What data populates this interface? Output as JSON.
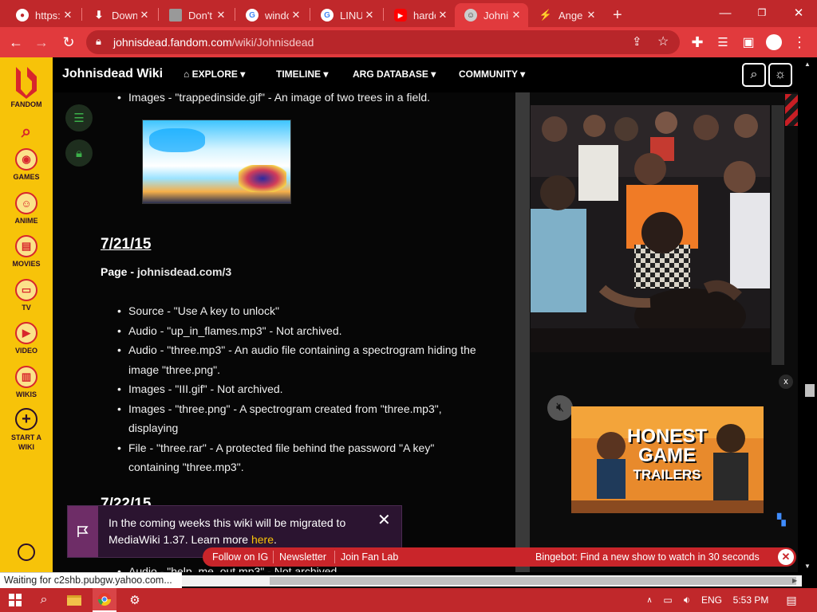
{
  "browser": {
    "tabs": [
      {
        "title": "https:",
        "icon": "github-icon",
        "active": false
      },
      {
        "title": "Down",
        "icon": "download-icon",
        "active": false
      },
      {
        "title": "Don't",
        "icon": "roblox-icon",
        "active": false
      },
      {
        "title": "windc",
        "icon": "google-icon",
        "active": false
      },
      {
        "title": "LINU",
        "icon": "google-icon",
        "active": false
      },
      {
        "title": "hardc",
        "icon": "youtube-icon",
        "active": false
      },
      {
        "title": "Johni",
        "icon": "fandom-favicon-icon",
        "active": true
      },
      {
        "title": "Ange",
        "icon": "bolt-icon",
        "active": false
      }
    ],
    "new_tab_label": "+",
    "url_host": "johnisdead.fandom.com",
    "url_path": "/wiki/Johnisdead",
    "status_text": "Waiting for c2shb.pubgw.yahoo.com..."
  },
  "fandom_rail": {
    "items": [
      {
        "label": "FANDOM",
        "icon": "fandom-logo-icon"
      },
      {
        "label": "",
        "icon": "search-icon"
      },
      {
        "label": "GAMES",
        "icon": "gamepad-icon"
      },
      {
        "label": "ANIME",
        "icon": "anime-icon"
      },
      {
        "label": "MOVIES",
        "icon": "film-icon"
      },
      {
        "label": "TV",
        "icon": "tv-icon"
      },
      {
        "label": "VIDEO",
        "icon": "play-icon"
      },
      {
        "label": "WIKIS",
        "icon": "book-icon"
      },
      {
        "label": "START A WIKI",
        "icon": "plus-icon"
      }
    ]
  },
  "wiki_header": {
    "name": "Johnisdead Wiki",
    "nav": [
      {
        "label": "EXPLORE"
      },
      {
        "label": "TIMELINE"
      },
      {
        "label": "ARG DATABASE"
      },
      {
        "label": "COMMUNITY"
      }
    ]
  },
  "content": {
    "top_bullet": "Images - \"trappedinside.gif\" - An image of two trees in a field.",
    "date_1": "7/21/15",
    "page_prefix": "Page - ",
    "page_link": "johnisdead.com/3",
    "bullets": [
      "Source - \"Use A key to unlock\"",
      "Audio - \"up_in_flames.mp3\" - Not archived.",
      "Audio - \"three.mp3\" - An audio file containing a spectrogram hiding the image \"three.png\".",
      "Images - \"III.gif\" - Not archived.",
      "Images - \"three.png\" - A spectrogram created from \"three.mp3\", displaying",
      "File - \"three.rar\" - A protected file behind the password \"A key\" containing \"three.mp3\"."
    ],
    "date_2": "7/22/15",
    "partial_bullet": "Audio - \"help_me_out.mp3\" - Not archived."
  },
  "video_ad": {
    "title_lines": [
      "HONEST",
      "GAME",
      "TRAILERS"
    ],
    "close_label": "x"
  },
  "notice": {
    "text": "In the coming weeks this wiki will be migrated to MediaWiki 1.37. Learn more ",
    "link": "here",
    "end": "."
  },
  "bottom_bar": {
    "links": [
      "Follow on IG",
      "Newsletter",
      "Join Fan Lab"
    ],
    "bingebot": "Bingebot: Find a new show to watch in 30 seconds"
  },
  "taskbar": {
    "language": "ENG",
    "time": "5:53 PM"
  },
  "colors": {
    "chrome_red": "#c0282b",
    "fandom_yellow": "#f7c309",
    "fandom_red": "#d8262c"
  }
}
